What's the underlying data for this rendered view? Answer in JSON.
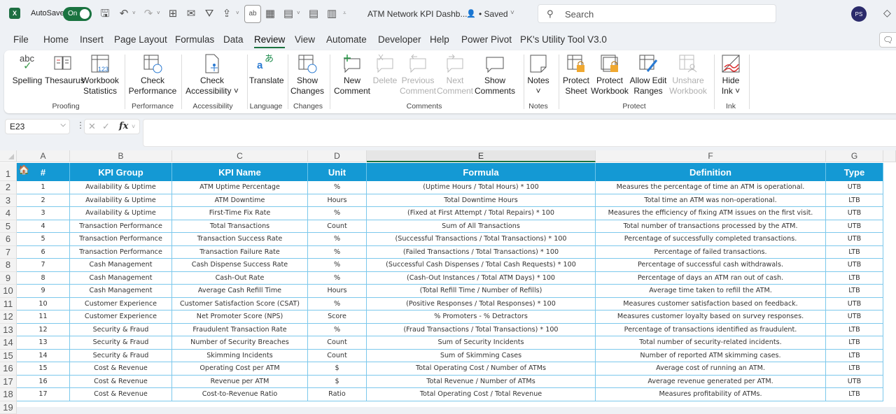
{
  "titlebar": {
    "app_icon": "excel-icon",
    "autosave_label": "AutoSave",
    "autosave_state": "On",
    "doc_title": "ATM Network KPI Dashb...",
    "save_status": "• Saved",
    "search_placeholder": "Search",
    "user_initials": "PS"
  },
  "menu": {
    "tabs": [
      "File",
      "Home",
      "Insert",
      "Page Layout",
      "Formulas",
      "Data",
      "Review",
      "View",
      "Automate",
      "Developer",
      "Help",
      "Power Pivot",
      "PK's Utility Tool V3.0"
    ],
    "active_tab": "Review"
  },
  "ribbon": {
    "buttons": {
      "spelling": "Spelling",
      "thesaurus": "Thesaurus",
      "workbook_statistics_1": "Workbook",
      "workbook_statistics_2": "Statistics",
      "check_performance_1": "Check",
      "check_performance_2": "Performance",
      "check_accessibility_1": "Check",
      "check_accessibility_2": "Accessibility ˅",
      "translate": "Translate",
      "show_changes_1": "Show",
      "show_changes_2": "Changes",
      "new_comment_1": "New",
      "new_comment_2": "Comment",
      "delete": "Delete",
      "previous_comment_1": "Previous",
      "previous_comment_2": "Comment",
      "next_comment_1": "Next",
      "next_comment_2": "Comment",
      "show_comments_1": "Show",
      "show_comments_2": "Comments",
      "notes_1": "Notes",
      "notes_2": "˅",
      "protect_sheet_1": "Protect",
      "protect_sheet_2": "Sheet",
      "protect_workbook_1": "Protect",
      "protect_workbook_2": "Workbook",
      "allow_edit_ranges_1": "Allow Edit",
      "allow_edit_ranges_2": "Ranges",
      "unshare_workbook_1": "Unshare",
      "unshare_workbook_2": "Workbook",
      "hide_ink_1": "Hide",
      "hide_ink_2": "Ink ˅"
    },
    "groups": {
      "proofing": "Proofing",
      "performance": "Performance",
      "accessibility": "Accessibility",
      "language": "Language",
      "changes": "Changes",
      "comments": "Comments",
      "notes": "Notes",
      "protect": "Protect",
      "ink": "Ink"
    }
  },
  "formula_bar": {
    "name_box": "E23",
    "formula": ""
  },
  "sheet": {
    "column_letters": [
      "A",
      "B",
      "C",
      "D",
      "E",
      "F",
      "G"
    ],
    "selected_column": "E",
    "row_numbers": [
      "1",
      "2",
      "3",
      "4",
      "5",
      "6",
      "7",
      "8",
      "9",
      "10",
      "11",
      "12",
      "13",
      "14",
      "15",
      "16",
      "17",
      "18"
    ],
    "headers": [
      "#",
      "KPI  Group",
      "KPI Name",
      "Unit",
      "Formula",
      "Definition",
      "Type"
    ],
    "header_color": "#1499D4",
    "rows": [
      [
        "1",
        "Availability & Uptime",
        "ATM Uptime Percentage",
        "%",
        "(Uptime Hours / Total Hours) * 100",
        "Measures the percentage of time an ATM is operational.",
        "UTB"
      ],
      [
        "2",
        "Availability & Uptime",
        "ATM Downtime",
        "Hours",
        "Total Downtime Hours",
        "Total time an ATM was non-operational.",
        "LTB"
      ],
      [
        "3",
        "Availability & Uptime",
        "First-Time Fix Rate",
        "%",
        "(Fixed at First Attempt / Total Repairs) * 100",
        "Measures the efficiency of fixing ATM issues on the first visit.",
        "UTB"
      ],
      [
        "4",
        "Transaction Performance",
        "Total Transactions",
        "Count",
        "Sum of All Transactions",
        "Total number of transactions processed by the ATM.",
        "UTB"
      ],
      [
        "5",
        "Transaction Performance",
        "Transaction Success Rate",
        "%",
        "(Successful Transactions / Total Transactions) * 100",
        "Percentage of successfully completed transactions.",
        "UTB"
      ],
      [
        "6",
        "Transaction Performance",
        "Transaction Failure Rate",
        "%",
        "(Failed Transactions / Total Transactions) * 100",
        "Percentage of failed transactions.",
        "LTB"
      ],
      [
        "7",
        "Cash Management",
        "Cash Dispense Success Rate",
        "%",
        "(Successful Cash Dispenses / Total Cash Requests) * 100",
        "Percentage of successful cash withdrawals.",
        "UTB"
      ],
      [
        "8",
        "Cash Management",
        "Cash-Out Rate",
        "%",
        "(Cash-Out Instances / Total ATM Days) * 100",
        "Percentage of days an ATM ran out of cash.",
        "LTB"
      ],
      [
        "9",
        "Cash Management",
        "Average Cash Refill Time",
        "Hours",
        "(Total Refill Time / Number of Refills)",
        "Average time taken to refill the ATM.",
        "LTB"
      ],
      [
        "10",
        "Customer Experience",
        "Customer Satisfaction Score (CSAT)",
        "%",
        "(Positive Responses / Total Responses) * 100",
        "Measures customer satisfaction based on feedback.",
        "UTB"
      ],
      [
        "11",
        "Customer Experience",
        "Net Promoter Score (NPS)",
        "Score",
        "% Promoters - % Detractors",
        "Measures customer loyalty based on survey responses.",
        "UTB"
      ],
      [
        "12",
        "Security & Fraud",
        "Fraudulent Transaction Rate",
        "%",
        "(Fraud Transactions / Total Transactions) * 100",
        "Percentage of transactions identified as fraudulent.",
        "LTB"
      ],
      [
        "13",
        "Security & Fraud",
        "Number of Security Breaches",
        "Count",
        "Sum of Security Incidents",
        "Total number of security-related incidents.",
        "LTB"
      ],
      [
        "14",
        "Security & Fraud",
        "Skimming Incidents",
        "Count",
        "Sum of Skimming Cases",
        "Number of reported ATM skimming cases.",
        "LTB"
      ],
      [
        "15",
        "Cost & Revenue",
        "Operating Cost per ATM",
        "$",
        "Total Operating Cost / Number of ATMs",
        "Average cost of running an ATM.",
        "LTB"
      ],
      [
        "16",
        "Cost & Revenue",
        "Revenue per ATM",
        "$",
        "Total Revenue / Number of ATMs",
        "Average revenue generated per ATM.",
        "UTB"
      ],
      [
        "17",
        "Cost & Revenue",
        "Cost-to-Revenue Ratio",
        "Ratio",
        "Total Operating Cost / Total Revenue",
        "Measures profitability of ATMs.",
        "LTB"
      ]
    ]
  }
}
